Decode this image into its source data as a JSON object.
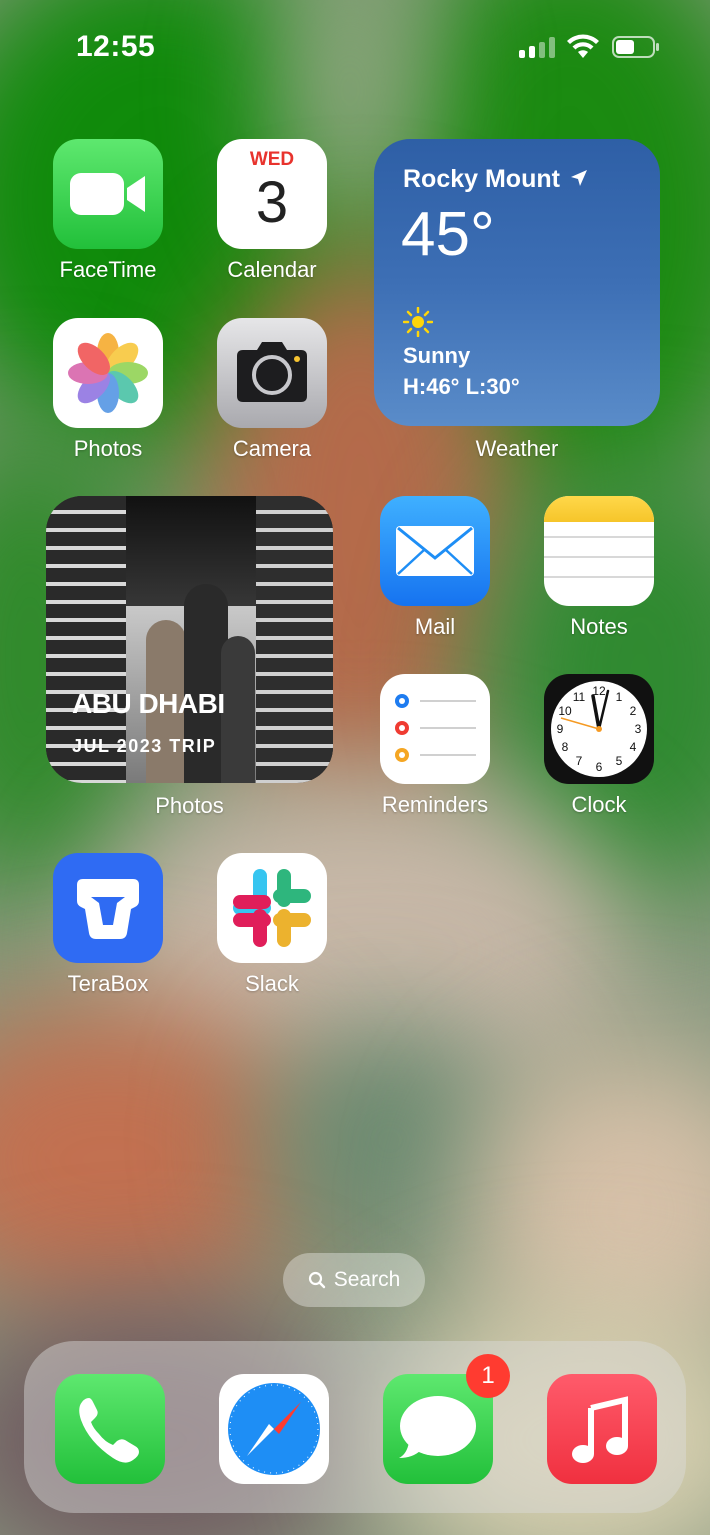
{
  "status_bar": {
    "time": "12:55"
  },
  "apps": {
    "facetime": "FaceTime",
    "calendar": "Calendar",
    "calendar_day": "WED",
    "calendar_date": "3",
    "photos": "Photos",
    "camera": "Camera",
    "mail": "Mail",
    "notes": "Notes",
    "reminders": "Reminders",
    "clock": "Clock",
    "terabox": "TeraBox",
    "slack": "Slack"
  },
  "weather_widget": {
    "city": "Rocky Mount",
    "temperature": "45°",
    "condition": "Sunny",
    "high_low": "H:46° L:30°",
    "label": "Weather"
  },
  "photos_widget": {
    "title": "ABU DHABI",
    "subtitle": "JUL 2023 TRIP",
    "label": "Photos"
  },
  "search": {
    "label": "Search"
  },
  "dock": {
    "items": [
      "Phone",
      "Safari",
      "Messages",
      "Music"
    ],
    "messages_badge": "1"
  },
  "colors": {
    "accent_red": "#ff3b30",
    "facetime_green": "#2fcc4f",
    "mail_blue": "#1e8ef5",
    "terabox_blue": "#2f6bf3"
  }
}
